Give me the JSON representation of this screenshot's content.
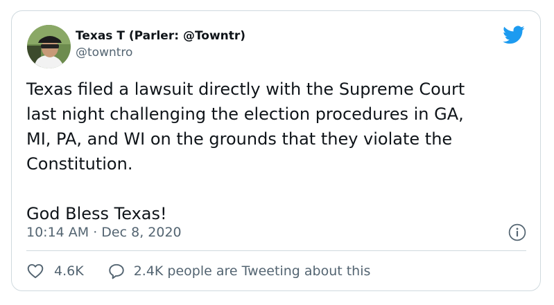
{
  "tweet": {
    "display_name": "Texas T (Parler: @Towntr)",
    "handle": "@towntro",
    "text": "Texas filed a lawsuit directly with the Supreme Court\nlast night challenging the election procedures in GA,\nMI, PA, and WI on the grounds that they violate the\nConstitution.\n\nGod Bless Texas!",
    "timestamp": "10:14 AM · Dec 8, 2020",
    "likes": "4.6K",
    "tweeting_text": "2.4K people are Tweeting about this"
  },
  "icons": {
    "logo": "twitter-bird-icon",
    "info": "info-icon",
    "like": "heart-icon",
    "reply": "speech-bubble-icon"
  },
  "colors": {
    "brand": "#1d9bf0",
    "text": "#0f1419",
    "muted": "#536471",
    "border": "#cfd9de"
  }
}
